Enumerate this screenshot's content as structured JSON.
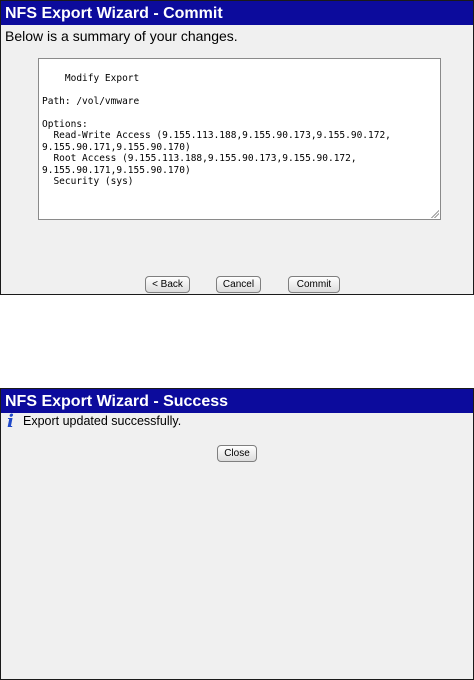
{
  "commit_dialog": {
    "title": "NFS Export Wizard - Commit",
    "summary_label": "Below is a summary of your changes.",
    "summary_text": "Modify Export\n\nPath: /vol/vmware\n\nOptions:\n  Read-Write Access (9.155.113.188,9.155.90.173,9.155.90.172,\n9.155.90.171,9.155.90.170)\n  Root Access (9.155.113.188,9.155.90.173,9.155.90.172,\n9.155.90.171,9.155.90.170)\n  Security (sys)",
    "buttons": {
      "back": "< Back",
      "cancel": "Cancel",
      "commit": "Commit"
    }
  },
  "success_dialog": {
    "title": "NFS Export Wizard - Success",
    "icon": "info-icon",
    "icon_glyph": "i",
    "message": "Export updated successfully.",
    "close_label": "Close"
  },
  "colors": {
    "titlebar": "#0c0b9c",
    "panel_bg": "#f0f0f0",
    "info_icon": "#1f48c8"
  }
}
